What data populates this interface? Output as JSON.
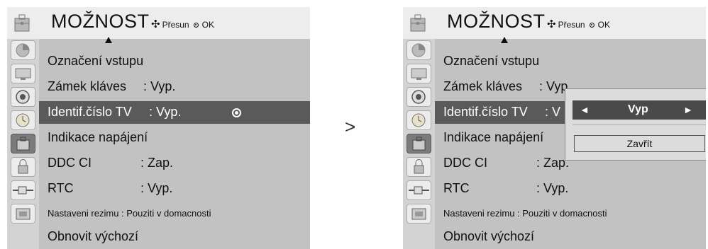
{
  "left_panel": {
    "title": "MOŽNOST",
    "hint_move": "Přesun",
    "hint_ok": "OK",
    "items": [
      {
        "label": "Označení vstupu",
        "value": ""
      },
      {
        "label": "Zámek kláves",
        "value": ": Vyp."
      },
      {
        "label": "Identif.číslo TV",
        "value": ": Vyp."
      },
      {
        "label": "Indikace napájení",
        "value": ""
      },
      {
        "label": "DDC CI",
        "value": ": Zap."
      },
      {
        "label": "RTC",
        "value": ": Vyp."
      },
      {
        "label": "Nastaveni rezimu : Pouziti v domacnosti",
        "value": ""
      },
      {
        "label": "Obnovit výchozí",
        "value": ""
      }
    ]
  },
  "arrow_between": ">",
  "right_panel": {
    "title": "MOŽNOST",
    "hint_move": "Přesun",
    "hint_ok": "OK",
    "items": [
      {
        "label": "Označení vstupu",
        "value": ""
      },
      {
        "label": "Zámek kláves",
        "value": ": Vyp."
      },
      {
        "label": "Identif.číslo TV",
        "value": ": V"
      },
      {
        "label": "Indikace napájení",
        "value": ""
      },
      {
        "label": "DDC CI",
        "value": ": Zap."
      },
      {
        "label": "RTC",
        "value": ": Vyp."
      },
      {
        "label": "Nastaveni rezimu : Pouziti v domacnosti",
        "value": ""
      },
      {
        "label": "Obnovit výchozí",
        "value": ""
      }
    ],
    "popup": {
      "value": "Vyp",
      "left_arrow": "◄",
      "right_arrow": "►",
      "close_label": "Zavřít"
    }
  },
  "sidebar_icons": [
    "picture-icon",
    "screen-icon",
    "sound-icon",
    "time-icon",
    "option-icon",
    "lock-icon",
    "input-icon",
    "usb-icon"
  ],
  "colors": {
    "header": "#ededed",
    "content": "#c2c2c2",
    "sidebar": "#d3d3d3",
    "selected": "#5a5a5a"
  }
}
